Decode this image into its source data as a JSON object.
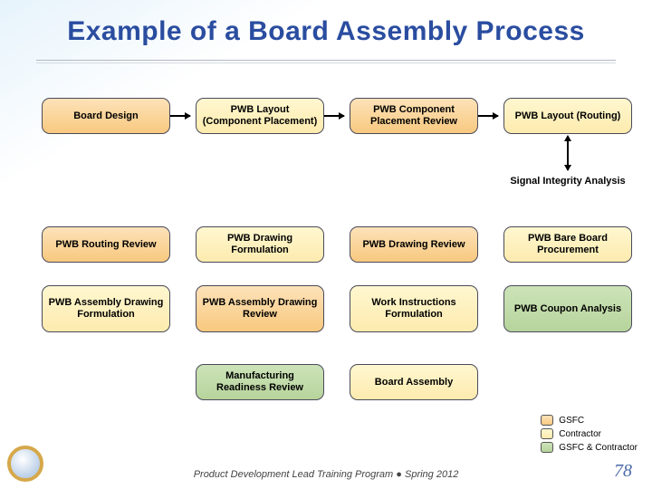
{
  "title": "Example of a Board Assembly Process",
  "boxes": {
    "r1c1": "Board Design",
    "r1c2": "PWB Layout (Component Placement)",
    "r1c3": "PWB Component Placement Review",
    "r1c4": "PWB Layout (Routing)",
    "signal": "Signal Integrity Analysis",
    "r3c1": "PWB Routing Review",
    "r3c2": "PWB Drawing Formulation",
    "r3c3": "PWB Drawing Review",
    "r3c4": "PWB Bare Board Procurement",
    "r4c1": "PWB Assembly Drawing Formulation",
    "r4c2": "PWB Assembly Drawing Review",
    "r4c3": "Work Instructions Formulation",
    "r4c4": "PWB Coupon Analysis",
    "r5c2": "Manufacturing Readiness Review",
    "r5c3": "Board Assembly"
  },
  "legend": {
    "gsfc": "GSFC",
    "contractor": "Contractor",
    "both": "GSFC & Contractor"
  },
  "footer": {
    "program": "Product Development Lead Training Program",
    "term": "Spring 2012"
  },
  "page": "78",
  "colors": {
    "gsfc": "#f8c97f",
    "contractor": "#fdebae",
    "both": "#b7d49c"
  }
}
